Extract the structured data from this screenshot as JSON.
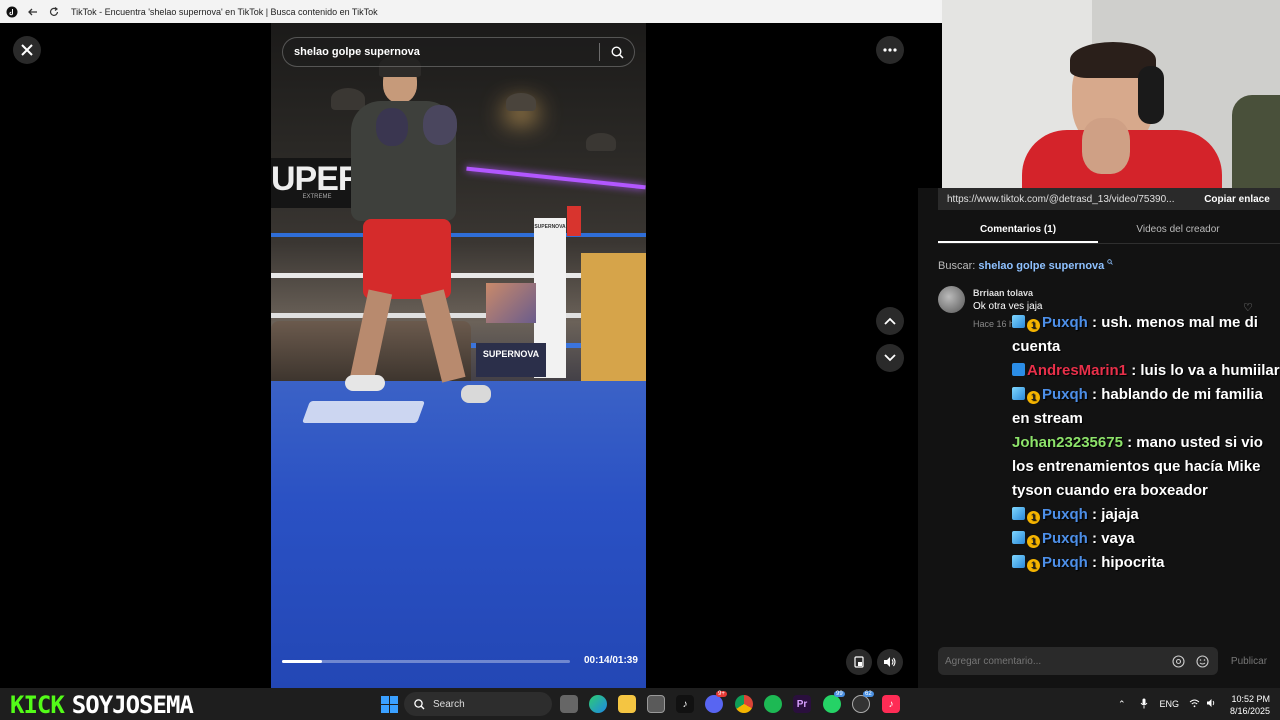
{
  "browser": {
    "title": "TikTok - Encuentra 'shelao supernova' en TikTok | Busca contenido en TikTok"
  },
  "player": {
    "search_value": "shelao golpe supernova",
    "time": "00:14/01:39",
    "progress": 0.14,
    "video_signage": {
      "banner": "UPERN",
      "banner_sub": "EXTREME",
      "ring_brand": "SUPERNOVA"
    }
  },
  "panel": {
    "link_url": "https://www.tiktok.com/@detrasd_13/video/75390...",
    "copy_link": "Copiar enlace",
    "tabs": [
      {
        "label": "Comentarios (1)",
        "active": true
      },
      {
        "label": "Videos del creador",
        "active": false
      }
    ],
    "related_prefix": "Buscar:",
    "related_query": "shelao golpe supernova",
    "comment": {
      "user": "Brriaan tolava",
      "text": "Ok otra ves jaja",
      "time": "Hace 16 h"
    },
    "comment_placeholder": "Agregar comentario...",
    "publish": "Publicar"
  },
  "chat": [
    {
      "badges": [
        "cube",
        "one"
      ],
      "user": "Puxqh",
      "user_color": "#4d8fe8",
      "message": "ush. menos mal me di cuenta"
    },
    {
      "badges": [
        "pin"
      ],
      "user": "AndresMarin1",
      "user_color": "#e8304a",
      "message": "luis lo va a humiilar"
    },
    {
      "badges": [
        "cube",
        "one"
      ],
      "user": "Puxqh",
      "user_color": "#4d8fe8",
      "message": "hablando de mi familia en stream"
    },
    {
      "badges": [],
      "user": "Johan23235675",
      "user_color": "#8de36a",
      "message": "mano usted si vio los entrenamientos que hacía Mike tyson cuando era boxeador"
    },
    {
      "badges": [
        "cube",
        "one"
      ],
      "user": "Puxqh",
      "user_color": "#4d8fe8",
      "message": "jajaja"
    },
    {
      "badges": [
        "cube",
        "one"
      ],
      "user": "Puxqh",
      "user_color": "#4d8fe8",
      "message": "vaya"
    },
    {
      "badges": [
        "cube",
        "one"
      ],
      "user": "Puxqh",
      "user_color": "#4d8fe8",
      "message": "hipocrita"
    }
  ],
  "overlay": {
    "kick_brand": "KICK",
    "channel": "SOYJOSEMA"
  },
  "taskbar": {
    "search_label": "Search",
    "lang": "ENG",
    "time": "10:52 PM",
    "date": "8/16/2025",
    "discord_badge": "9+",
    "whatsapp_badge": "99",
    "chrome_badge": "62"
  },
  "colors": {
    "kick_green": "#53fc18",
    "tiktok_accent": "#fe2c55",
    "link_blue": "#8ec1ff"
  }
}
